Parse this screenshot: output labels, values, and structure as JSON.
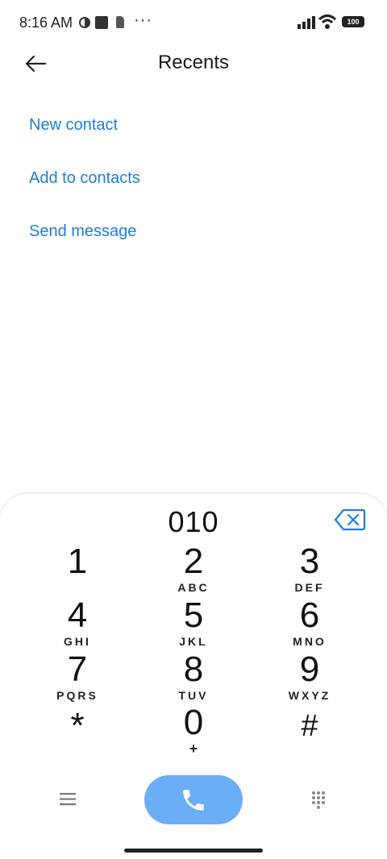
{
  "status_bar": {
    "time": "8:16 AM",
    "more": "···",
    "battery": "100",
    "icons": [
      "vpn-icon",
      "square-notification-icon",
      "sim-icon",
      "signal-icon",
      "wifi-icon",
      "battery-icon"
    ]
  },
  "header": {
    "title": "Recents",
    "back_icon": "arrow-left-icon"
  },
  "actions": [
    "New contact",
    "Add to contacts",
    "Send message"
  ],
  "accent_color": "#1a7fe0",
  "dialpad": {
    "entered_number": "010",
    "keys": [
      {
        "digit": "1",
        "letters": ""
      },
      {
        "digit": "2",
        "letters": "ABC"
      },
      {
        "digit": "3",
        "letters": "DEF"
      },
      {
        "digit": "4",
        "letters": "GHI"
      },
      {
        "digit": "5",
        "letters": "JKL"
      },
      {
        "digit": "6",
        "letters": "MNO"
      },
      {
        "digit": "7",
        "letters": "PQRS"
      },
      {
        "digit": "8",
        "letters": "TUV"
      },
      {
        "digit": "9",
        "letters": "WXYZ"
      },
      {
        "digit": "*",
        "letters": ""
      },
      {
        "digit": "0",
        "letters": "+"
      },
      {
        "digit": "#",
        "letters": ""
      }
    ],
    "call_button_color": "#6aaef7"
  }
}
